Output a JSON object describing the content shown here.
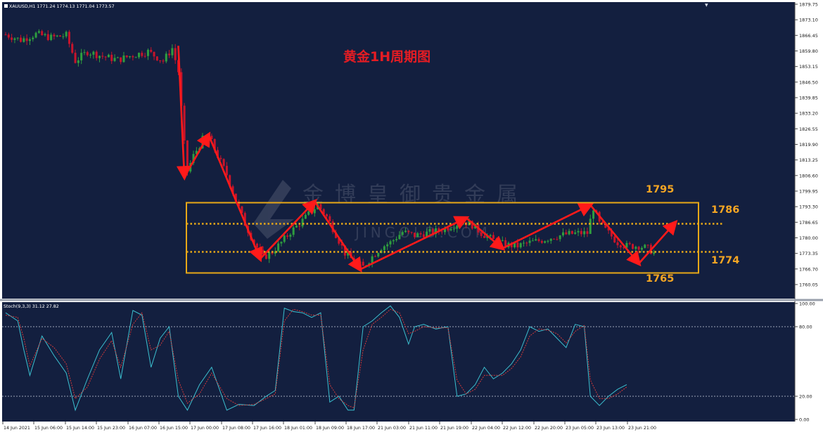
{
  "header": {
    "symbol_info": "XAUUSD,H1  1771.24 1774.13 1771.04 1773.57"
  },
  "main": {
    "title": "黄金1H周期图",
    "watermark": "金博皇御贵金属",
    "watermark_latin": "JINGOLD.COM"
  },
  "stoch": {
    "label": "Stoch(9,3,3) 31.12 27.82"
  },
  "annotations": {
    "top": "1795",
    "upper": "1786",
    "lower": "1774",
    "bottom": "1765"
  },
  "colors": {
    "chart_bg": "#131f3f",
    "up_candle": "#2e9e3f",
    "down_candle": "#c8142b",
    "arrow": "#ff1a1a",
    "box": "#e8a817",
    "annotation_text": "#f5a623",
    "title_text": "#e51c23",
    "stoch_main": "#3bbfcf",
    "stoch_signal": "#d23a3a"
  },
  "chart_data": [
    {
      "type": "candlestick",
      "symbol": "XAUUSD",
      "timeframe": "H1",
      "title": "黄金1H周期图",
      "ylim": [
        1760.05,
        1879.75
      ],
      "y_ticks": [
        "1879.75",
        "1873.10",
        "1866.45",
        "1859.80",
        "1853.15",
        "1846.50",
        "1839.85",
        "1833.20",
        "1826.55",
        "1819.90",
        "1813.25",
        "1806.60",
        "1799.95",
        "1793.30",
        "1786.65",
        "1780.00",
        "1773.35",
        "1766.70",
        "1760.05"
      ],
      "x_ticks": [
        "14 Jun 2021",
        "15 Jun 06:00",
        "15 Jun 14:00",
        "15 Jun 23:00",
        "16 Jun 07:00",
        "16 Jun 15:00",
        "17 Jun 00:00",
        "17 Jun 08:00",
        "17 Jun 16:00",
        "18 Jun 01:00",
        "18 Jun 09:00",
        "18 Jun 17:00",
        "21 Jun 03:00",
        "21 Jun 11:00",
        "21 Jun 19:00",
        "22 Jun 04:00",
        "22 Jun 12:00",
        "22 Jun 20:00",
        "23 Jun 05:00",
        "23 Jun 13:00",
        "23 Jun 21:00"
      ],
      "grid": false,
      "price_path": [
        {
          "x": 0,
          "y": 1866.8
        },
        {
          "x": 5,
          "y": 1864.5
        },
        {
          "x": 10,
          "y": 1867.0
        },
        {
          "x": 15,
          "y": 1865.5
        },
        {
          "x": 20,
          "y": 1866.5
        },
        {
          "x": 23,
          "y": 1855.5
        },
        {
          "x": 27,
          "y": 1859.5
        },
        {
          "x": 32,
          "y": 1857.5
        },
        {
          "x": 37,
          "y": 1856.0
        },
        {
          "x": 42,
          "y": 1858.0
        },
        {
          "x": 47,
          "y": 1859.5
        },
        {
          "x": 52,
          "y": 1855.5
        },
        {
          "x": 55,
          "y": 1861.0
        },
        {
          "x": 57,
          "y": 1851.0
        },
        {
          "x": 59,
          "y": 1820.0
        },
        {
          "x": 60,
          "y": 1808.5
        },
        {
          "x": 62,
          "y": 1815.0
        },
        {
          "x": 65,
          "y": 1822.0
        },
        {
          "x": 67,
          "y": 1823.5
        },
        {
          "x": 70,
          "y": 1815.0
        },
        {
          "x": 73,
          "y": 1807.0
        },
        {
          "x": 76,
          "y": 1796.0
        },
        {
          "x": 79,
          "y": 1786.0
        },
        {
          "x": 82,
          "y": 1778.0
        },
        {
          "x": 85,
          "y": 1771.5
        },
        {
          "x": 88,
          "y": 1774.0
        },
        {
          "x": 91,
          "y": 1778.0
        },
        {
          "x": 94,
          "y": 1782.5
        },
        {
          "x": 97,
          "y": 1786.0
        },
        {
          "x": 100,
          "y": 1790.0
        },
        {
          "x": 103,
          "y": 1794.0
        },
        {
          "x": 106,
          "y": 1789.0
        },
        {
          "x": 109,
          "y": 1781.5
        },
        {
          "x": 112,
          "y": 1773.5
        },
        {
          "x": 115,
          "y": 1770.0
        },
        {
          "x": 118,
          "y": 1767.5
        },
        {
          "x": 121,
          "y": 1772.0
        },
        {
          "x": 124,
          "y": 1776.0
        },
        {
          "x": 127,
          "y": 1778.0
        },
        {
          "x": 131,
          "y": 1782.5
        },
        {
          "x": 135,
          "y": 1781.0
        },
        {
          "x": 139,
          "y": 1782.0
        },
        {
          "x": 143,
          "y": 1783.0
        },
        {
          "x": 147,
          "y": 1785.0
        },
        {
          "x": 151,
          "y": 1787.0
        },
        {
          "x": 154,
          "y": 1785.5
        },
        {
          "x": 157,
          "y": 1782.0
        },
        {
          "x": 161,
          "y": 1779.0
        },
        {
          "x": 165,
          "y": 1777.0
        },
        {
          "x": 169,
          "y": 1776.5
        },
        {
          "x": 173,
          "y": 1778.0
        },
        {
          "x": 177,
          "y": 1779.0
        },
        {
          "x": 181,
          "y": 1780.5
        },
        {
          "x": 185,
          "y": 1781.5
        },
        {
          "x": 189,
          "y": 1782.0
        },
        {
          "x": 192,
          "y": 1782.0
        },
        {
          "x": 194,
          "y": 1793.0
        },
        {
          "x": 196,
          "y": 1786.0
        },
        {
          "x": 199,
          "y": 1782.0
        },
        {
          "x": 202,
          "y": 1778.0
        },
        {
          "x": 205,
          "y": 1776.5
        },
        {
          "x": 209,
          "y": 1776.5
        },
        {
          "x": 212,
          "y": 1775.5
        },
        {
          "x": 214,
          "y": 1773.5
        }
      ],
      "annotations": {
        "box": {
          "top": 1795,
          "bottom": 1765
        },
        "dotted_levels": [
          1786,
          1774
        ],
        "arrow_path": [
          {
            "x": 57,
            "y": 1862.0
          },
          {
            "x": 59,
            "y": 1806.0
          },
          {
            "x": 67,
            "y": 1824.0
          },
          {
            "x": 84,
            "y": 1771.0
          },
          {
            "x": 102,
            "y": 1795.5
          },
          {
            "x": 117,
            "y": 1766.5
          },
          {
            "x": 152,
            "y": 1788.5
          },
          {
            "x": 164,
            "y": 1775.5
          },
          {
            "x": 193,
            "y": 1794.0
          },
          {
            "x": 209,
            "y": 1769.0
          },
          {
            "x": 221,
            "y": 1786.5
          }
        ],
        "labels": [
          "1795",
          "1786",
          "1774",
          "1765"
        ]
      }
    },
    {
      "type": "line",
      "title": "Stoch(9,3,3) 31.12 27.82",
      "ylim": [
        0,
        100
      ],
      "y_ticks": [
        "100.00",
        "80.00",
        "20.00",
        "0.00"
      ],
      "levels": [
        80,
        20
      ],
      "series": [
        {
          "name": "main",
          "values": [
            [
              0,
              92
            ],
            [
              4,
              85
            ],
            [
              6,
              60
            ],
            [
              8,
              38
            ],
            [
              12,
              72
            ],
            [
              16,
              55
            ],
            [
              20,
              40
            ],
            [
              23,
              8
            ],
            [
              27,
              35
            ],
            [
              31,
              60
            ],
            [
              35,
              75
            ],
            [
              38,
              35
            ],
            [
              42,
              94
            ],
            [
              45,
              90
            ],
            [
              48,
              45
            ],
            [
              51,
              70
            ],
            [
              54,
              80
            ],
            [
              57,
              20
            ],
            [
              60,
              8
            ],
            [
              64,
              30
            ],
            [
              68,
              45
            ],
            [
              73,
              8
            ],
            [
              77,
              13
            ],
            [
              82,
              12
            ],
            [
              86,
              20
            ],
            [
              89,
              25
            ],
            [
              92,
              96
            ],
            [
              95,
              93
            ],
            [
              98,
              92
            ],
            [
              101,
              88
            ],
            [
              104,
              92
            ],
            [
              107,
              15
            ],
            [
              110,
              20
            ],
            [
              113,
              8
            ],
            [
              115,
              8
            ],
            [
              118,
              80
            ],
            [
              121,
              85
            ],
            [
              124,
              92
            ],
            [
              127,
              98
            ],
            [
              130,
              88
            ],
            [
              133,
              65
            ],
            [
              135,
              80
            ],
            [
              138,
              82
            ],
            [
              142,
              78
            ],
            [
              146,
              80
            ],
            [
              149,
              20
            ],
            [
              152,
              22
            ],
            [
              155,
              30
            ],
            [
              158,
              45
            ],
            [
              161,
              35
            ],
            [
              164,
              40
            ],
            [
              167,
              48
            ],
            [
              170,
              60
            ],
            [
              173,
              80
            ],
            [
              176,
              76
            ],
            [
              179,
              78
            ],
            [
              182,
              70
            ],
            [
              185,
              62
            ],
            [
              188,
              82
            ],
            [
              191,
              80
            ],
            [
              193,
              20
            ],
            [
              196,
              12
            ],
            [
              199,
              20
            ],
            [
              202,
              26
            ],
            [
              205,
              30
            ]
          ]
        },
        {
          "name": "signal",
          "values": [
            [
              0,
              90
            ],
            [
              4,
              88
            ],
            [
              6,
              70
            ],
            [
              8,
              46
            ],
            [
              12,
              70
            ],
            [
              16,
              62
            ],
            [
              20,
              48
            ],
            [
              23,
              18
            ],
            [
              27,
              28
            ],
            [
              31,
              52
            ],
            [
              35,
              68
            ],
            [
              38,
              45
            ],
            [
              42,
              82
            ],
            [
              45,
              92
            ],
            [
              48,
              60
            ],
            [
              51,
              64
            ],
            [
              54,
              76
            ],
            [
              57,
              34
            ],
            [
              60,
              14
            ],
            [
              64,
              22
            ],
            [
              68,
              40
            ],
            [
              73,
              18
            ],
            [
              77,
              12
            ],
            [
              82,
              13
            ],
            [
              86,
              18
            ],
            [
              89,
              22
            ],
            [
              92,
              85
            ],
            [
              95,
              95
            ],
            [
              98,
              93
            ],
            [
              101,
              90
            ],
            [
              104,
              90
            ],
            [
              107,
              30
            ],
            [
              110,
              18
            ],
            [
              113,
              12
            ],
            [
              115,
              10
            ],
            [
              118,
              60
            ],
            [
              121,
              82
            ],
            [
              124,
              88
            ],
            [
              127,
              95
            ],
            [
              130,
              92
            ],
            [
              133,
              74
            ],
            [
              135,
              76
            ],
            [
              138,
              80
            ],
            [
              142,
              79
            ],
            [
              146,
              79
            ],
            [
              149,
              34
            ],
            [
              152,
              22
            ],
            [
              155,
              26
            ],
            [
              158,
              38
            ],
            [
              161,
              38
            ],
            [
              164,
              38
            ],
            [
              167,
              44
            ],
            [
              170,
              54
            ],
            [
              173,
              72
            ],
            [
              176,
              78
            ],
            [
              179,
              77
            ],
            [
              182,
              74
            ],
            [
              185,
              66
            ],
            [
              188,
              76
            ],
            [
              191,
              81
            ],
            [
              193,
              34
            ],
            [
              196,
              18
            ],
            [
              199,
              18
            ],
            [
              202,
              22
            ],
            [
              205,
              28
            ]
          ]
        }
      ]
    }
  ]
}
